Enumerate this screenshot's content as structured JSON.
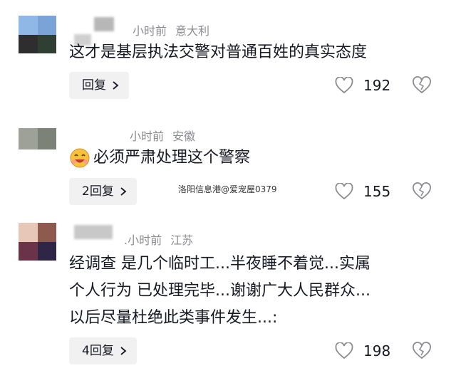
{
  "comments": [
    {
      "avatar_colors": [
        "#8fb8e6",
        "#7aa3d8",
        "#2e2e2e",
        "#2f4032"
      ],
      "time": "小时前",
      "location": "意大利",
      "text": "这才是基层执法交警对普通百姓的真实态度",
      "reply_label": "回复",
      "likes": "192"
    },
    {
      "avatar_colors": [
        "#9ea197",
        "#7d8277",
        "#ffffff",
        "#ffffff"
      ],
      "time": "小时前",
      "location": "安徽",
      "text": "必须严肃处理这个警察",
      "reply_label": "2回复",
      "likes": "155"
    },
    {
      "avatar_colors": [
        "#e6c7b8",
        "#8d5a4d",
        "#6a3347",
        "#2f2547"
      ],
      "time": ".小时前",
      "location": "江苏",
      "text_lines": [
        "经调查 是几个临时工...半夜睡不着觉...实属",
        "个人行为 已处理完毕...谢谢广大人民群众...",
        "以后尽量杜绝此类事件发生...:"
      ],
      "reply_label": "4回复",
      "likes": "198"
    }
  ],
  "watermark": "洛阳信息港@爱宠屋0379",
  "icons": {
    "like": "heart-outline-icon",
    "dislike": "broken-heart-icon",
    "reply_chevron": "chevron-right-icon"
  }
}
